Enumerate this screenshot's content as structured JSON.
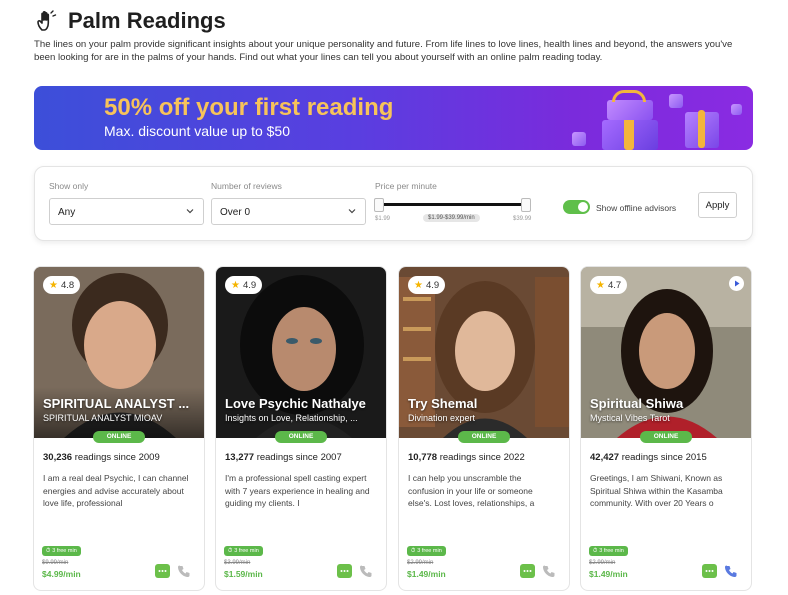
{
  "page": {
    "title": "Palm Readings",
    "intro": "The lines on your palm provide significant insights about your unique personality and future. From life lines to love lines, health lines and beyond, the answers you've been looking for are in the palms of your hands. Find out what your lines can tell you about yourself with an online palm reading today.",
    "title_icon": "hand-icon"
  },
  "promo": {
    "title": "50% off your first reading",
    "subtitle": "Max. discount value up to $50",
    "colors": {
      "title": "#f7c35a",
      "gradient_start": "#3c4fd9",
      "gradient_end": "#8a2be2"
    }
  },
  "filters": {
    "show_only_label": "Show only",
    "show_only_value": "Any",
    "reviews_label": "Number of reviews",
    "reviews_value": "Over 0",
    "price_label": "Price per minute",
    "price_min": "$1.99",
    "price_max": "$39.99",
    "price_range": "$1.99-$39.99/min",
    "offline_label": "Show offline advisors",
    "offline_enabled": true,
    "apply_label": "Apply"
  },
  "advisors": [
    {
      "rating": "4.8",
      "name": "SPIRITUAL ANALYST ...",
      "tagline": "SPIRITUAL ANALYST MIOAV",
      "status": "ONLINE",
      "readings_count": "30,236",
      "readings_since": " readings since 2009",
      "bio": "I am a real deal Psychic, I can channel energies and advise accurately about love life, professional",
      "free_min": "3 free min",
      "old_price": "$9.99/min",
      "price": "$4.99/min",
      "has_video": false
    },
    {
      "rating": "4.9",
      "name": "Love Psychic Nathalye",
      "tagline": "Insights on Love, Relationship, ...",
      "status": "ONLINE",
      "readings_count": "13,277",
      "readings_since": " readings since 2007",
      "bio": "I'm a professional spell casting expert with 7 years experience in healing and guiding my clients. I",
      "free_min": "3 free min",
      "old_price": "$3.99/min",
      "price": "$1.59/min",
      "has_video": false
    },
    {
      "rating": "4.9",
      "name": "Try Shemal",
      "tagline": "Divination expert",
      "status": "ONLINE",
      "readings_count": "10,778",
      "readings_since": " readings since 2022",
      "bio": "I can help you unscramble the confusion in your life or someone else's. Lost loves, relationships, a",
      "free_min": "3 free min",
      "old_price": "$2.99/min",
      "price": "$1.49/min",
      "has_video": false
    },
    {
      "rating": "4.7",
      "name": "Spiritual Shiwa",
      "tagline": "Mystical Vibes Tarot",
      "status": "ONLINE",
      "readings_count": "42,427",
      "readings_since": " readings since 2015",
      "bio": "Greetings, I am Shiwani, Known as Spiritual Shiwa within the Kasamba community. With over 20 Years o",
      "free_min": "3 free min",
      "old_price": "$2.99/min",
      "price": "$1.49/min",
      "has_video": true
    }
  ],
  "colors": {
    "online": "#5cb84a",
    "price": "#5cb84a",
    "rating_star": "#f5b400"
  }
}
